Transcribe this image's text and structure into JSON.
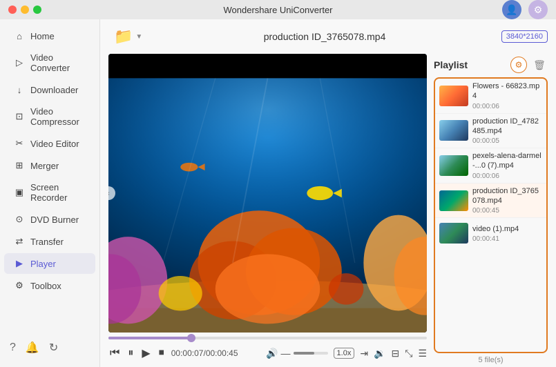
{
  "app": {
    "title": "Wondershare UniConverter"
  },
  "titlebar": {
    "title": "Wondershare UniConverter",
    "user_icon": "👤",
    "settings_icon": "⚙"
  },
  "sidebar": {
    "items": [
      {
        "id": "home",
        "label": "Home",
        "icon": "⌂"
      },
      {
        "id": "video-converter",
        "label": "Video Converter",
        "icon": "▷"
      },
      {
        "id": "downloader",
        "label": "Downloader",
        "icon": "↓"
      },
      {
        "id": "video-compressor",
        "label": "Video Compressor",
        "icon": "⊡"
      },
      {
        "id": "video-editor",
        "label": "Video Editor",
        "icon": "✂"
      },
      {
        "id": "merger",
        "label": "Merger",
        "icon": "⊞"
      },
      {
        "id": "screen-recorder",
        "label": "Screen Recorder",
        "icon": "▣"
      },
      {
        "id": "dvd-burner",
        "label": "DVD Burner",
        "icon": "⊙"
      },
      {
        "id": "transfer",
        "label": "Transfer",
        "icon": "⇄"
      },
      {
        "id": "player",
        "label": "Player",
        "icon": "▶",
        "active": true
      },
      {
        "id": "toolbox",
        "label": "Toolbox",
        "icon": "⚙"
      }
    ],
    "bottom_icons": [
      "?",
      "🔔",
      "↻"
    ]
  },
  "toolbar": {
    "add_file_icon": "📁",
    "file_title": "production ID_3765078.mp4",
    "resolution": "3840*2160"
  },
  "player": {
    "current_time": "00:00:07",
    "total_time": "00:00:45",
    "progress_pct": 26,
    "speed": "1.0x"
  },
  "playlist": {
    "title": "Playlist",
    "file_count": "5 file(s)",
    "items": [
      {
        "id": 1,
        "name": "Flowers - 66823.mp4",
        "duration": "00:00:06",
        "thumb_class": "pl-thumb-1",
        "active": false
      },
      {
        "id": 2,
        "name": "production ID_4782485.mp4",
        "duration": "00:00:05",
        "thumb_class": "pl-thumb-2",
        "active": false
      },
      {
        "id": 3,
        "name": "pexels-alena-darmel-...0 (7).mp4",
        "duration": "00:00:06",
        "thumb_class": "pl-thumb-3",
        "active": false
      },
      {
        "id": 4,
        "name": "production ID_3765078.mp4",
        "duration": "00:00:45",
        "thumb_class": "pl-thumb-4",
        "active": true
      },
      {
        "id": 5,
        "name": "video (1).mp4",
        "duration": "00:00:41",
        "thumb_class": "pl-thumb-5",
        "active": false
      }
    ]
  }
}
